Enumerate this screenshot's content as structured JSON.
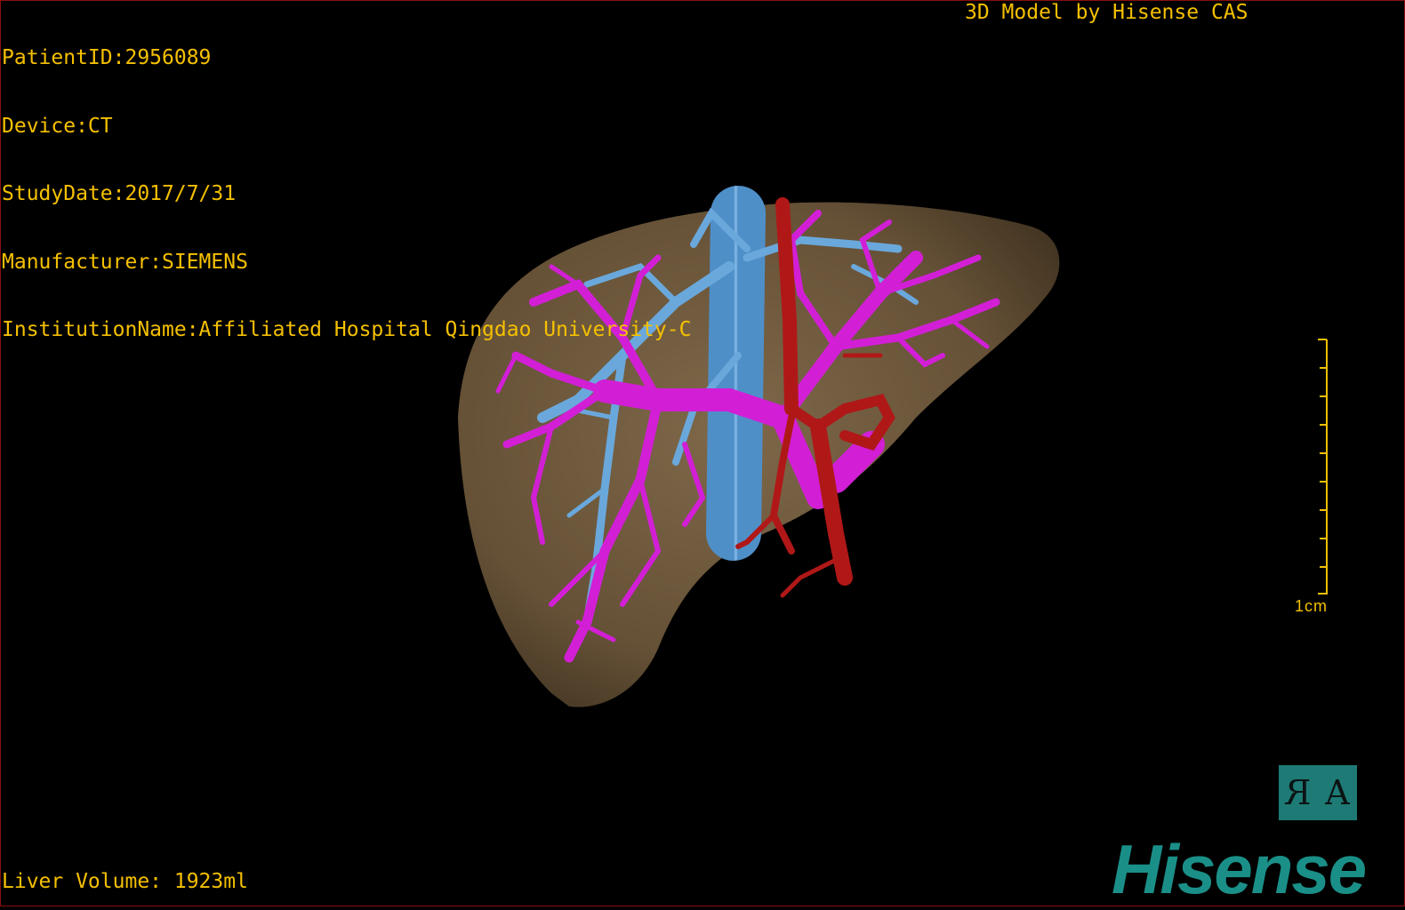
{
  "overlay": {
    "patient_id": "PatientID:2956089",
    "device": "Device:CT",
    "study_date": "StudyDate:2017/7/31",
    "manufacturer": "Manufacturer:SIEMENS",
    "institution": "InstitutionName:Affiliated Hospital Qingdao University-C",
    "model_credit": "3D Model by Hisense CAS",
    "liver_volume": "Liver Volume: 1923ml"
  },
  "scale_bar": {
    "label": "1cm"
  },
  "orientation_cube": {
    "left_glyph": "R",
    "right_glyph": "A"
  },
  "brand": {
    "logo_text": "Hisense"
  },
  "colors": {
    "overlay_text": "#f5c000",
    "liver": "#7a6345",
    "hepatic_vein": "#6aa8dc",
    "portal_vein": "#d21fd6",
    "artery": "#b01818",
    "brand": "#1a8f88",
    "frame": "#8a1010"
  }
}
